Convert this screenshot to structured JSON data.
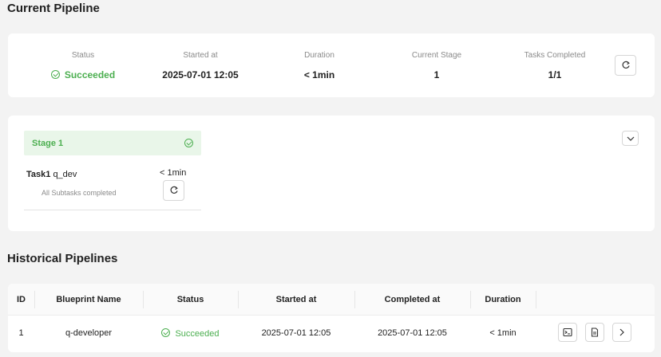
{
  "current": {
    "title": "Current Pipeline",
    "metrics": [
      {
        "label": "Status",
        "value": "Succeeded",
        "status": "success"
      },
      {
        "label": "Started at",
        "value": "2025-07-01 12:05"
      },
      {
        "label": "Duration",
        "value": "< 1min"
      },
      {
        "label": "Current Stage",
        "value": "1"
      },
      {
        "label": "Tasks Completed",
        "value": "1/1"
      }
    ]
  },
  "stage": {
    "name": "Stage 1",
    "task_id": "Task1",
    "task_name": "q_dev",
    "duration": "< 1min",
    "subtitle": "All Subtasks completed"
  },
  "history": {
    "title": "Historical Pipelines",
    "columns": [
      "ID",
      "Blueprint Name",
      "Status",
      "Started at",
      "Completed at",
      "Duration"
    ],
    "rows": [
      {
        "id": "1",
        "blueprint": "q-developer",
        "status": "Succeeded",
        "started": "2025-07-01 12:05",
        "completed": "2025-07-01 12:05",
        "duration": "< 1min"
      }
    ]
  },
  "colors": {
    "success": "#4caf50",
    "success_bg": "#e9f6e9",
    "muted": "#8a8a8a"
  },
  "icons": [
    "check-circle-icon",
    "refresh-icon",
    "chevron-down-icon",
    "terminal-icon",
    "document-icon",
    "chevron-right-icon"
  ]
}
